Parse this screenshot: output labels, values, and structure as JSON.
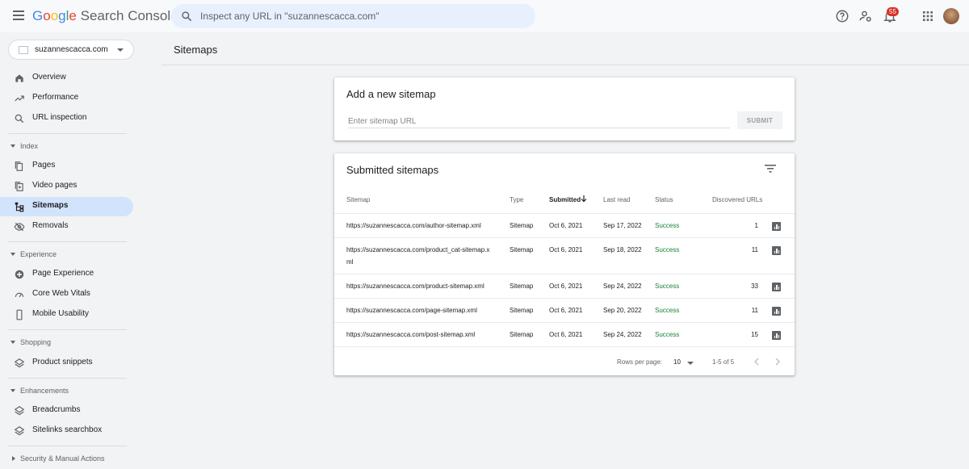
{
  "header": {
    "search_placeholder": "Inspect any URL in \"suzannescacca.com\"",
    "notification_count": "55"
  },
  "sidebar": {
    "property": "suzannescacca.com",
    "nav_top": [
      {
        "label": "Overview",
        "icon": "home-icon"
      },
      {
        "label": "Performance",
        "icon": "trending-up-icon"
      },
      {
        "label": "URL inspection",
        "icon": "search-icon"
      }
    ],
    "sections": {
      "index": "Index",
      "experience": "Experience",
      "shopping": "Shopping",
      "enhancements": "Enhancements",
      "security": "Security & Manual Actions"
    },
    "index_items": [
      "Pages",
      "Video pages",
      "Sitemaps",
      "Removals"
    ],
    "experience_items": [
      "Page Experience",
      "Core Web Vitals",
      "Mobile Usability"
    ],
    "shopping_items": [
      "Product snippets"
    ],
    "enhancement_items": [
      "Breadcrumbs",
      "Sitelinks searchbox"
    ]
  },
  "main": {
    "title": "Sitemaps",
    "add_card": {
      "title": "Add a new sitemap",
      "input_placeholder": "Enter sitemap URL",
      "submit_label": "SUBMIT"
    },
    "submitted_card": {
      "title": "Submitted sitemaps",
      "columns": [
        "Sitemap",
        "Type",
        "Submitted",
        "Last read",
        "Status",
        "Discovered URLs"
      ],
      "rows": [
        {
          "sitemap": "https://suzannescacca.com/author-sitemap.xml",
          "type": "Sitemap",
          "submitted": "Oct 6, 2021",
          "last_read": "Sep 17, 2022",
          "status": "Success",
          "discovered": "1"
        },
        {
          "sitemap_line1": "https://suzannescacca.com/product_cat-sitemap.x",
          "sitemap_line2": "ml",
          "type": "Sitemap",
          "submitted": "Oct 6, 2021",
          "last_read": "Sep 18, 2022",
          "status": "Success",
          "discovered": "11"
        },
        {
          "sitemap": "https://suzannescacca.com/product-sitemap.xml",
          "type": "Sitemap",
          "submitted": "Oct 6, 2021",
          "last_read": "Sep 24, 2022",
          "status": "Success",
          "discovered": "33"
        },
        {
          "sitemap": "https://suzannescacca.com/page-sitemap.xml",
          "type": "Sitemap",
          "submitted": "Oct 6, 2021",
          "last_read": "Sep 20, 2022",
          "status": "Success",
          "discovered": "11"
        },
        {
          "sitemap": "https://suzannescacca.com/post-sitemap.xml",
          "type": "Sitemap",
          "submitted": "Oct 6, 2021",
          "last_read": "Sep 24, 2022",
          "status": "Success",
          "discovered": "15"
        }
      ],
      "footer": {
        "rows_per_page_label": "Rows per page:",
        "rows_per_page_value": "10",
        "range": "1-5 of 5"
      }
    }
  },
  "colors": {
    "accent": "#1a73e8",
    "active_nav": "#d2e3fc",
    "success": "#188038",
    "badge": "#d93025"
  }
}
